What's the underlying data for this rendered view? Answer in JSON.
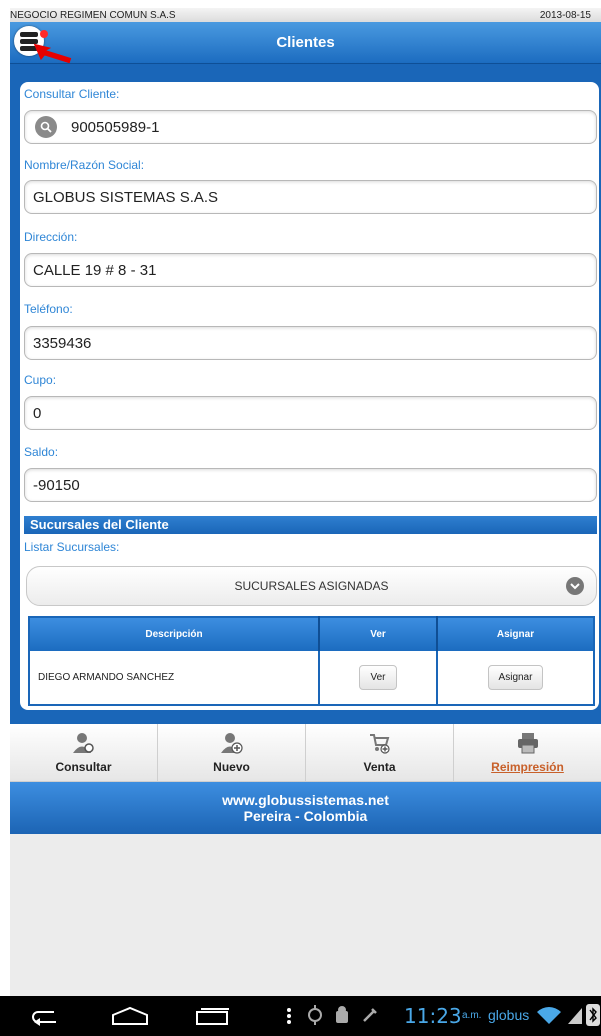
{
  "status_strip": {
    "company": "NEGOCIO REGIMEN COMUN S.A.S",
    "date": "2013-08-15"
  },
  "header": {
    "title": "Clientes",
    "menu_icon": "list-menu-icon"
  },
  "form": {
    "consultar_label": "Consultar Cliente:",
    "consultar_value": "900505989-1",
    "nombre_label": "Nombre/Razón Social:",
    "nombre_value": "GLOBUS SISTEMAS S.A.S",
    "direccion_label": "Dirección:",
    "direccion_value": "CALLE 19 # 8 - 31",
    "telefono_label": "Teléfono:",
    "telefono_value": "3359436",
    "cupo_label": "Cupo:",
    "cupo_value": "0",
    "saldo_label": "Saldo:",
    "saldo_value": "-90150"
  },
  "sucursales": {
    "section_title": "Sucursales del Cliente",
    "listar_label": "Listar Sucursales:",
    "select_value": "SUCURSALES ASIGNADAS",
    "columns": [
      "Descripción",
      "Ver",
      "Asignar"
    ],
    "rows": [
      {
        "descripcion": "DIEGO ARMANDO SANCHEZ",
        "ver": "Ver",
        "asignar": "Asignar"
      }
    ]
  },
  "nav": {
    "items": [
      {
        "label": "Consultar",
        "icon": "user-search-icon"
      },
      {
        "label": "Nuevo",
        "icon": "user-add-icon"
      },
      {
        "label": "Venta",
        "icon": "cart-add-icon"
      },
      {
        "label": "Reimpresión",
        "icon": "printer-icon",
        "active": true
      }
    ]
  },
  "footer": {
    "line1": "www.globussistemas.net",
    "line2": "Pereira - Colombia"
  },
  "system_bar": {
    "time": "11:23",
    "ampm": "a.m.",
    "carrier": "globus"
  },
  "colors": {
    "primary_blue": "#1a66b8",
    "label_blue": "#2f86d6",
    "active_orange": "#c8602a"
  }
}
